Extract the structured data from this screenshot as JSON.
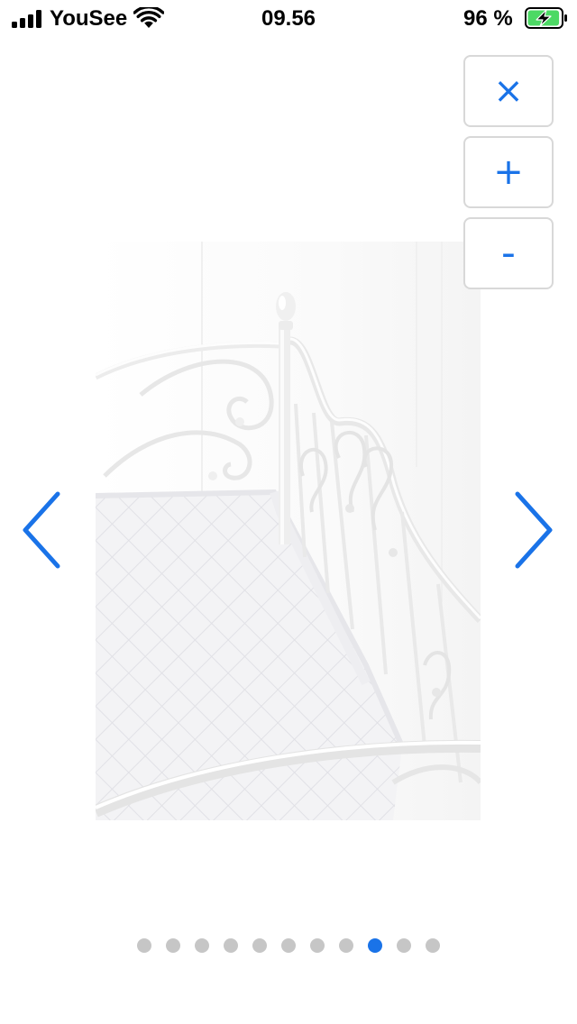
{
  "status_bar": {
    "carrier": "YouSee",
    "time": "09.56",
    "battery_percent": "96 %",
    "signal_bars": 4,
    "battery_level": 0.96,
    "charging": true,
    "icons": [
      "cellular-signal-icon",
      "wifi-icon",
      "battery-charging-icon"
    ]
  },
  "gallery": {
    "image_subject": "white metal daybed with scroll frame and quilted mattress",
    "controls": {
      "close_label": "×",
      "zoom_in_label": "+",
      "zoom_out_label": "-"
    },
    "navigation": {
      "prev_icon": "chevron-left-icon",
      "next_icon": "chevron-right-icon"
    },
    "pagination": {
      "total": 11,
      "current": 9
    },
    "colors": {
      "accent": "#1a73e8",
      "dot_inactive": "#c6c6c6",
      "button_border": "#d8d8d8"
    }
  }
}
